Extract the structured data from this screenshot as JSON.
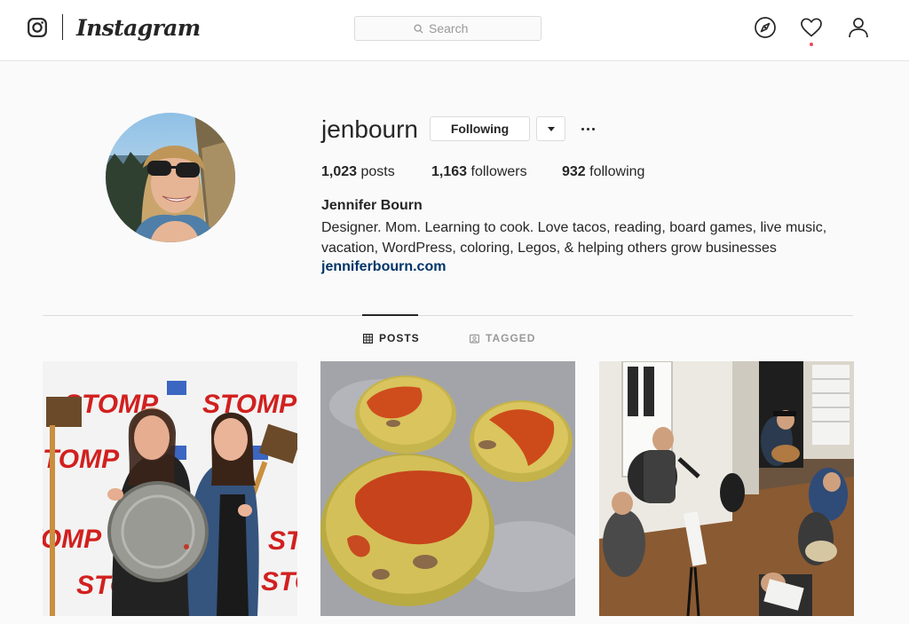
{
  "nav": {
    "brand": "Instagram",
    "search_placeholder": "Search"
  },
  "profile": {
    "username": "jenbourn",
    "follow_button": "Following",
    "stats": {
      "posts_count": "1,023",
      "posts_label": "posts",
      "followers_count": "1,163",
      "followers_label": "followers",
      "following_count": "932",
      "following_label": "following"
    },
    "full_name": "Jennifer Bourn",
    "bio": "Designer. Mom. Learning to cook. Love tacos, reading, board games, live music, vacation, WordPress, coloring, Legos, & helping others grow businesses",
    "website": "jenniferbourn.com"
  },
  "tabs": [
    {
      "label": "POSTS",
      "icon": "grid-icon",
      "active": true
    },
    {
      "label": "TAGGED",
      "icon": "tagged-icon",
      "active": false
    }
  ],
  "posts": [
    {
      "kind": "stomp-photo",
      "banner_text": "STOMP"
    },
    {
      "kind": "egg-muffins-photo"
    },
    {
      "kind": "music-jam-photo"
    }
  ],
  "colors": {
    "background": "#fafafa",
    "text": "#262626",
    "link": "#003569",
    "muted": "#999999",
    "border": "#dbdbdb",
    "notification": "#ed4956"
  }
}
